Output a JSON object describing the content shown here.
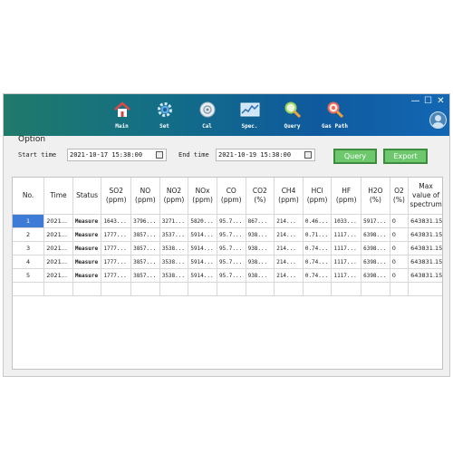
{
  "nav": {
    "items": [
      {
        "label": "Main",
        "icon": "home-icon"
      },
      {
        "label": "Set",
        "icon": "gear-icon"
      },
      {
        "label": "Cal",
        "icon": "calibration-icon"
      },
      {
        "label": "Spec.",
        "icon": "spectrum-icon"
      },
      {
        "label": "Query",
        "icon": "magnifier-icon"
      },
      {
        "label": "Gas Path",
        "icon": "gas-path-icon"
      }
    ]
  },
  "window_controls": {
    "minimize": "—",
    "maximize": "☐",
    "close": "✕"
  },
  "option": {
    "title": "Option",
    "start_label": "Start time",
    "start_value": "2021-10-17 15:38:00",
    "end_label": "End time",
    "end_value": "2021-10-19 15:38:00",
    "query_label": "Query",
    "export_label": "Export"
  },
  "table": {
    "headers": [
      "No.",
      "Time",
      "Status",
      "SO2\n(ppm)",
      "NO\n(ppm)",
      "NO2\n(ppm)",
      "NOx\n(ppm)",
      "CO\n(ppm)",
      "CO2\n(%)",
      "CH4\n(ppm)",
      "HCl\n(ppm)",
      "HF\n(ppm)",
      "H2O\n(%)",
      "O2\n(%)",
      "Max\nvalue of\nspectrum"
    ],
    "rows": [
      [
        "1",
        "2021...",
        "Measure",
        "1643...",
        "3796...",
        "3271...",
        "5820...",
        "95.7...",
        "867...",
        "214...",
        "0.46...",
        "1033...",
        "5917...",
        "0",
        "643831.15"
      ],
      [
        "2",
        "2021...",
        "Measure",
        "1777...",
        "3857...",
        "3537...",
        "5914...",
        "95.7...",
        "938...",
        "214...",
        "0.71...",
        "1117...",
        "6398...",
        "0",
        "643831.15"
      ],
      [
        "3",
        "2021...",
        "Measure",
        "1777...",
        "3857...",
        "3538...",
        "5914...",
        "95.7...",
        "938...",
        "214...",
        "0.74...",
        "1117...",
        "6398...",
        "0",
        "643831.15"
      ],
      [
        "4",
        "2021...",
        "Measure",
        "1777...",
        "3857...",
        "3538...",
        "5914...",
        "95.7...",
        "938...",
        "214...",
        "0.74...",
        "1117...",
        "6398...",
        "0",
        "643831.15"
      ],
      [
        "5",
        "2021...",
        "Measure",
        "1777...",
        "3857...",
        "3538...",
        "5914...",
        "95.7...",
        "938...",
        "214...",
        "0.74...",
        "1117...",
        "6398...",
        "0",
        "643831.15"
      ]
    ]
  }
}
